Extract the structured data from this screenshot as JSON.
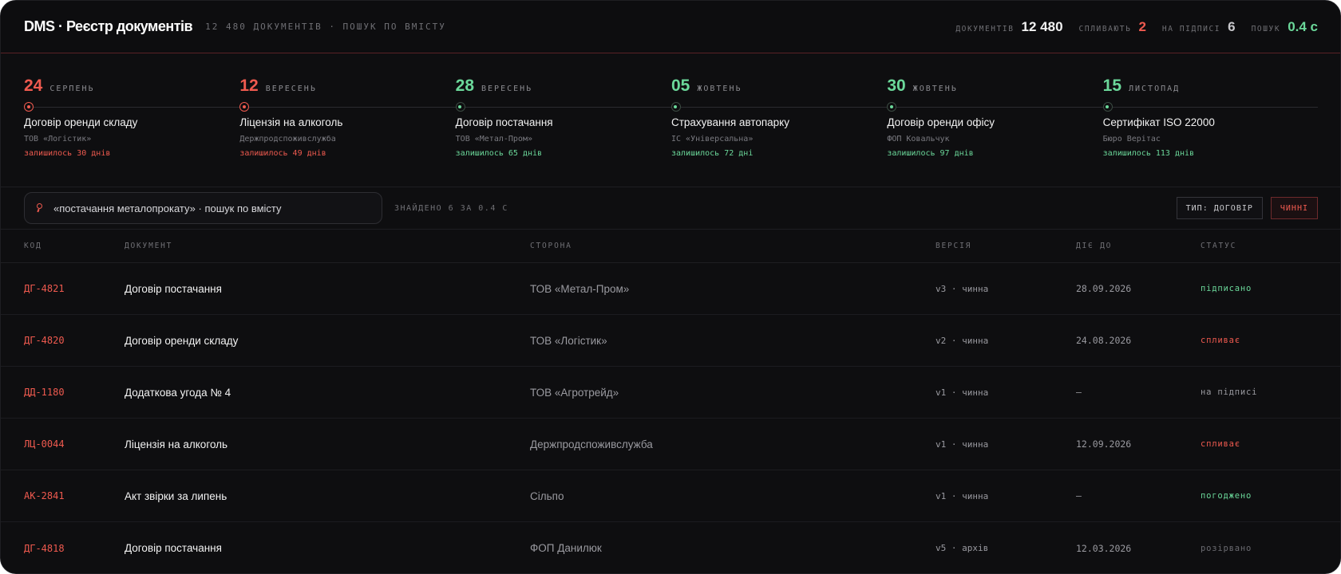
{
  "header": {
    "title": "DMS · Реєстр документів",
    "subtitle": "12 480 ДОКУМЕНТІВ · ПОШУК ПО ВМІСТУ",
    "stats": [
      {
        "label": "документів",
        "value": "12 480",
        "color": "#f2f2f2"
      },
      {
        "label": "спливають",
        "value": "2",
        "color": "#ef5a4f"
      },
      {
        "label": "на підписі",
        "value": "6",
        "color": "#c8c8cc"
      },
      {
        "label": "пошук",
        "value": "0.4 с",
        "color": "#6bd89a"
      }
    ]
  },
  "deadlines": [
    {
      "day": "24",
      "month": "СЕРПЕНЬ",
      "title": "Договір оренди складу",
      "party": "ТОВ «Логістик»",
      "left": "залишилось 30 днів",
      "urgent": true
    },
    {
      "day": "12",
      "month": "ВЕРЕСЕНЬ",
      "title": "Ліцензія на алкоголь",
      "party": "Держпродспоживслужба",
      "left": "залишилось 49 днів",
      "urgent": true
    },
    {
      "day": "28",
      "month": "ВЕРЕСЕНЬ",
      "title": "Договір постачання",
      "party": "ТОВ «Метал-Пром»",
      "left": "залишилось 65 днів",
      "urgent": false
    },
    {
      "day": "05",
      "month": "ЖОВТЕНЬ",
      "title": "Страхування автопарку",
      "party": "ІС «Універсальна»",
      "left": "залишилось 72 дні",
      "urgent": false
    },
    {
      "day": "30",
      "month": "ЖОВТЕНЬ",
      "title": "Договір оренди офісу",
      "party": "ФОП Ковальчук",
      "left": "залишилось 97 днів",
      "urgent": false
    },
    {
      "day": "15",
      "month": "ЛИСТОПАД",
      "title": "Сертифікат ISO 22000",
      "party": "Бюро Верітас",
      "left": "залишилось 113 днів",
      "urgent": false
    }
  ],
  "search": {
    "value": "«постачання металопрокату» · пошук по вмісту",
    "found": "ЗНАЙДЕНО 6 ЗА 0.4 С",
    "filter_type": "ТИП: ДОГОВІР",
    "filter_active": "ЧИННІ"
  },
  "table": {
    "columns": [
      "КОД",
      "ДОКУМЕНТ",
      "СТОРОНА",
      "ВЕРСІЯ",
      "ДІЄ ДО",
      "СТАТУС"
    ],
    "rows": [
      {
        "code": "ДГ-4821",
        "doc": "Договір постачання",
        "party": "ТОВ «Метал-Пром»",
        "version": "v3 · чинна",
        "date": "28.09.2026",
        "status": "підписано",
        "status_kind": "signed"
      },
      {
        "code": "ДГ-4820",
        "doc": "Договір оренди складу",
        "party": "ТОВ «Логістик»",
        "version": "v2 · чинна",
        "date": "24.08.2026",
        "status": "спливає",
        "status_kind": "expiring"
      },
      {
        "code": "ДД-1180",
        "doc": "Додаткова угода № 4",
        "party": "ТОВ «Агротрейд»",
        "version": "v1 · чинна",
        "date": "—",
        "status": "на підписі",
        "status_kind": "pending"
      },
      {
        "code": "ЛЦ-0044",
        "doc": "Ліцензія на алкоголь",
        "party": "Держпродспоживслужба",
        "version": "v1 · чинна",
        "date": "12.09.2026",
        "status": "спливає",
        "status_kind": "expiring"
      },
      {
        "code": "АК-2841",
        "doc": "Акт звірки за липень",
        "party": "Сільпо",
        "version": "v1 · чинна",
        "date": "—",
        "status": "погоджено",
        "status_kind": "approved"
      },
      {
        "code": "ДГ-4818",
        "doc": "Договір постачання",
        "party": "ФОП Данилюк",
        "version": "v5 · архів",
        "date": "12.03.2026",
        "status": "розірвано",
        "status_kind": "terminated"
      }
    ]
  },
  "colors": {
    "accent_red": "#ef5a4f",
    "accent_green": "#6bd89a",
    "background": "#0e0e10"
  }
}
